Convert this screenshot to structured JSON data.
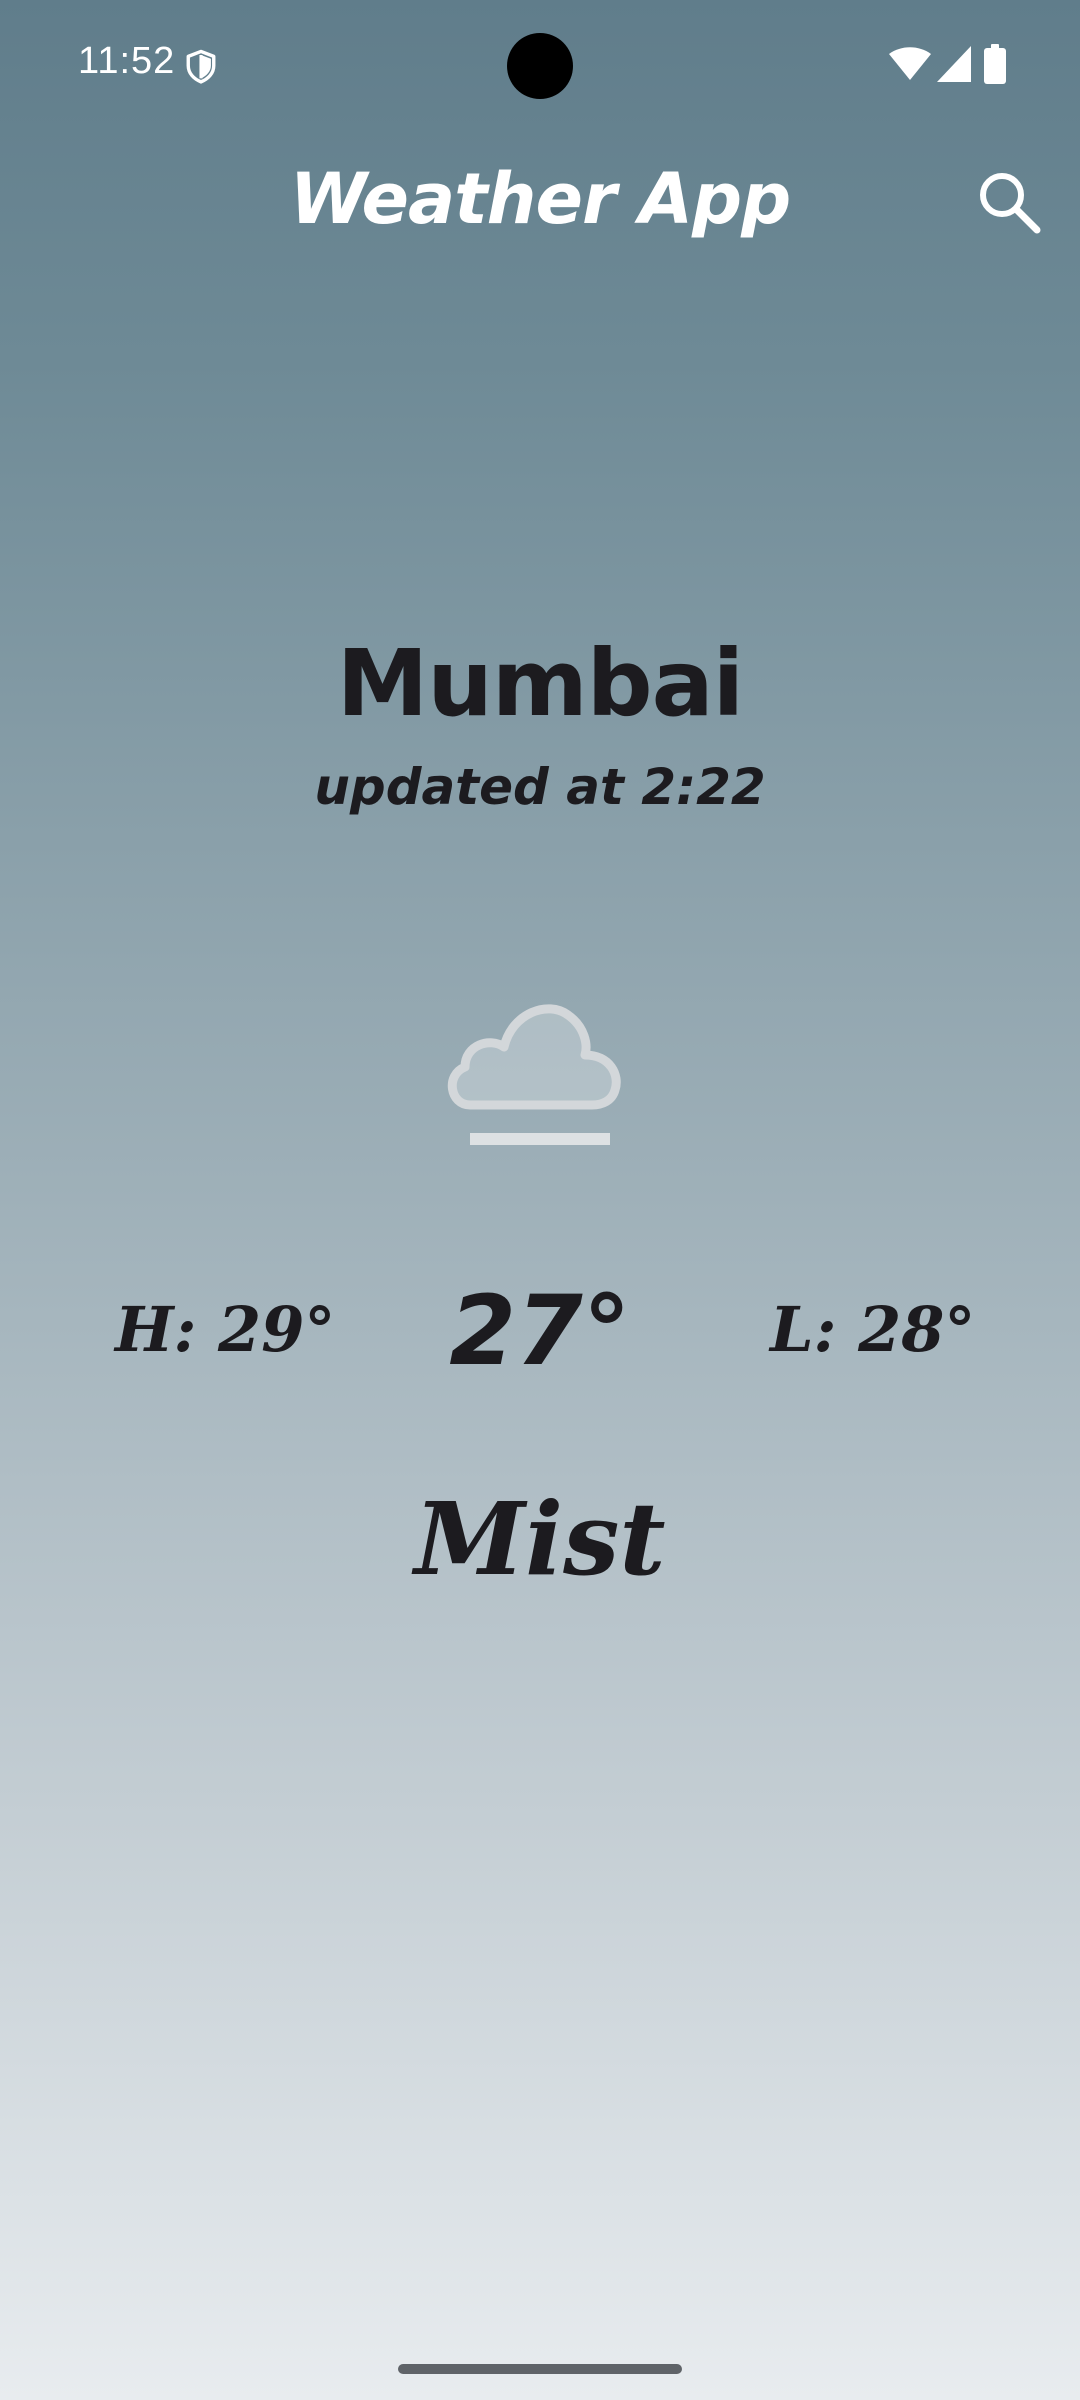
{
  "status_bar": {
    "time": "11:52",
    "icons": [
      "shield-icon",
      "wifi-icon",
      "cell-signal-icon",
      "battery-icon"
    ]
  },
  "app_bar": {
    "title": "Weather App",
    "search_icon": "search-icon"
  },
  "weather": {
    "city": "Mumbai",
    "updated": "updated at 2:22",
    "icon": "mist-cloud-icon",
    "high": "H: 29°",
    "current": "27°",
    "low": "L: 28°",
    "condition": "Mist"
  },
  "colors": {
    "gradient_top": "#607d8b",
    "gradient_bottom": "#e8ecef",
    "text_dark": "#1c1b1f",
    "text_light": "#ffffff"
  }
}
